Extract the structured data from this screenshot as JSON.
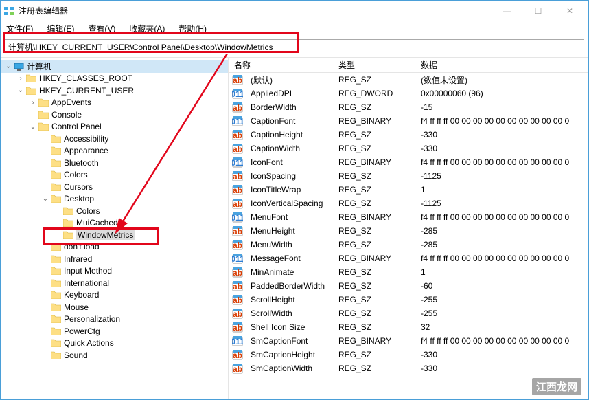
{
  "window": {
    "title": "注册表编辑器",
    "min": "—",
    "max": "☐",
    "close": "✕"
  },
  "menu": {
    "file": "文件(F)",
    "edit": "编辑(E)",
    "view": "查看(V)",
    "fav": "收藏夹(A)",
    "help": "帮助(H)"
  },
  "address": "计算机\\HKEY_CURRENT_USER\\Control Panel\\Desktop\\WindowMetrics",
  "columns": {
    "name": "名称",
    "type": "类型",
    "data": "数据"
  },
  "tree": [
    {
      "indent": 0,
      "exp": "v",
      "icon": "computer",
      "label": "计算机",
      "selBg": true
    },
    {
      "indent": 1,
      "exp": ">",
      "icon": "folder",
      "label": "HKEY_CLASSES_ROOT"
    },
    {
      "indent": 1,
      "exp": "v",
      "icon": "folder",
      "label": "HKEY_CURRENT_USER"
    },
    {
      "indent": 2,
      "exp": ">",
      "icon": "folder",
      "label": "AppEvents"
    },
    {
      "indent": 2,
      "exp": "",
      "icon": "folder",
      "label": "Console"
    },
    {
      "indent": 2,
      "exp": "v",
      "icon": "folder",
      "label": "Control Panel"
    },
    {
      "indent": 3,
      "exp": "",
      "icon": "folder",
      "label": "Accessibility"
    },
    {
      "indent": 3,
      "exp": "",
      "icon": "folder",
      "label": "Appearance"
    },
    {
      "indent": 3,
      "exp": "",
      "icon": "folder",
      "label": "Bluetooth"
    },
    {
      "indent": 3,
      "exp": "",
      "icon": "folder",
      "label": "Colors"
    },
    {
      "indent": 3,
      "exp": "",
      "icon": "folder",
      "label": "Cursors"
    },
    {
      "indent": 3,
      "exp": "v",
      "icon": "folder",
      "label": "Desktop"
    },
    {
      "indent": 4,
      "exp": "",
      "icon": "folder",
      "label": "Colors"
    },
    {
      "indent": 4,
      "exp": "",
      "icon": "folder",
      "label": "MuiCached"
    },
    {
      "indent": 4,
      "exp": "",
      "icon": "folder",
      "label": "WindowMetrics",
      "selected": true
    },
    {
      "indent": 3,
      "exp": "",
      "icon": "folder",
      "label": "don't load"
    },
    {
      "indent": 3,
      "exp": "",
      "icon": "folder",
      "label": "Infrared"
    },
    {
      "indent": 3,
      "exp": "",
      "icon": "folder",
      "label": "Input Method"
    },
    {
      "indent": 3,
      "exp": "",
      "icon": "folder",
      "label": "International"
    },
    {
      "indent": 3,
      "exp": "",
      "icon": "folder",
      "label": "Keyboard"
    },
    {
      "indent": 3,
      "exp": "",
      "icon": "folder",
      "label": "Mouse"
    },
    {
      "indent": 3,
      "exp": "",
      "icon": "folder",
      "label": "Personalization"
    },
    {
      "indent": 3,
      "exp": "",
      "icon": "folder",
      "label": "PowerCfg"
    },
    {
      "indent": 3,
      "exp": "",
      "icon": "folder",
      "label": "Quick Actions"
    },
    {
      "indent": 3,
      "exp": "",
      "icon": "folder",
      "label": "Sound"
    }
  ],
  "values": [
    {
      "icon": "sz",
      "name": "(默认)",
      "type": "REG_SZ",
      "data": "(数值未设置)"
    },
    {
      "icon": "bin",
      "name": "AppliedDPI",
      "type": "REG_DWORD",
      "data": "0x00000060 (96)"
    },
    {
      "icon": "sz",
      "name": "BorderWidth",
      "type": "REG_SZ",
      "data": "-15"
    },
    {
      "icon": "bin",
      "name": "CaptionFont",
      "type": "REG_BINARY",
      "data": "f4 ff ff ff 00 00 00 00 00 00 00 00 00 00 0"
    },
    {
      "icon": "sz",
      "name": "CaptionHeight",
      "type": "REG_SZ",
      "data": "-330"
    },
    {
      "icon": "sz",
      "name": "CaptionWidth",
      "type": "REG_SZ",
      "data": "-330"
    },
    {
      "icon": "bin",
      "name": "IconFont",
      "type": "REG_BINARY",
      "data": "f4 ff ff ff 00 00 00 00 00 00 00 00 00 00 0"
    },
    {
      "icon": "sz",
      "name": "IconSpacing",
      "type": "REG_SZ",
      "data": "-1125"
    },
    {
      "icon": "sz",
      "name": "IconTitleWrap",
      "type": "REG_SZ",
      "data": "1"
    },
    {
      "icon": "sz",
      "name": "IconVerticalSpacing",
      "type": "REG_SZ",
      "data": "-1125"
    },
    {
      "icon": "bin",
      "name": "MenuFont",
      "type": "REG_BINARY",
      "data": "f4 ff ff ff 00 00 00 00 00 00 00 00 00 00 0"
    },
    {
      "icon": "sz",
      "name": "MenuHeight",
      "type": "REG_SZ",
      "data": "-285"
    },
    {
      "icon": "sz",
      "name": "MenuWidth",
      "type": "REG_SZ",
      "data": "-285"
    },
    {
      "icon": "bin",
      "name": "MessageFont",
      "type": "REG_BINARY",
      "data": "f4 ff ff ff 00 00 00 00 00 00 00 00 00 00 0"
    },
    {
      "icon": "sz",
      "name": "MinAnimate",
      "type": "REG_SZ",
      "data": "1"
    },
    {
      "icon": "sz",
      "name": "PaddedBorderWidth",
      "type": "REG_SZ",
      "data": "-60"
    },
    {
      "icon": "sz",
      "name": "ScrollHeight",
      "type": "REG_SZ",
      "data": "-255"
    },
    {
      "icon": "sz",
      "name": "ScrollWidth",
      "type": "REG_SZ",
      "data": "-255"
    },
    {
      "icon": "sz",
      "name": "Shell Icon Size",
      "type": "REG_SZ",
      "data": "32"
    },
    {
      "icon": "bin",
      "name": "SmCaptionFont",
      "type": "REG_BINARY",
      "data": "f4 ff ff ff 00 00 00 00 00 00 00 00 00 00 0"
    },
    {
      "icon": "sz",
      "name": "SmCaptionHeight",
      "type": "REG_SZ",
      "data": "-330"
    },
    {
      "icon": "sz",
      "name": "SmCaptionWidth",
      "type": "REG_SZ",
      "data": "-330"
    }
  ],
  "watermark": "江西龙网",
  "colors": {
    "highlight": "#e2061b"
  }
}
